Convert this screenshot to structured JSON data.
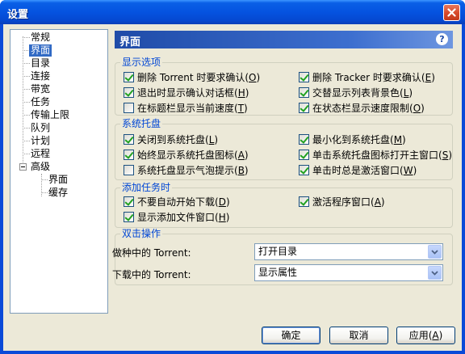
{
  "window": {
    "title": "设置"
  },
  "tree": {
    "items": [
      {
        "label": "常规"
      },
      {
        "label": "界面"
      },
      {
        "label": "目录"
      },
      {
        "label": "连接"
      },
      {
        "label": "带宽"
      },
      {
        "label": "任务"
      },
      {
        "label": "传输上限"
      },
      {
        "label": "队列"
      },
      {
        "label": "计划"
      },
      {
        "label": "远程"
      },
      {
        "label": "高级"
      },
      {
        "label": "界面"
      },
      {
        "label": "缓存"
      }
    ],
    "selected": "界面"
  },
  "header": {
    "title": "界面",
    "help": "?"
  },
  "groups": {
    "display": {
      "title": "显示选项",
      "items": [
        {
          "text": "删除 Torrent 时要求确认(",
          "key": "O",
          "end": ")",
          "checked": true
        },
        {
          "text": "删除 Tracker 时要求确认(",
          "key": "E",
          "end": ")",
          "checked": true
        },
        {
          "text": "退出时显示确认对话框(",
          "key": "H",
          "end": ")",
          "checked": true
        },
        {
          "text": "交替显示列表背景色(",
          "key": "L",
          "end": ")",
          "checked": true
        },
        {
          "text": "在标题栏显示当前速度(",
          "key": "T",
          "end": ")",
          "checked": false
        },
        {
          "text": "在状态栏显示速度限制(",
          "key": "O",
          "end": ")",
          "checked": true
        }
      ]
    },
    "tray": {
      "title": "系统托盘",
      "items": [
        {
          "text": "关闭到系统托盘(",
          "key": "L",
          "end": ")",
          "checked": true
        },
        {
          "text": "最小化到系统托盘(",
          "key": "M",
          "end": ")",
          "checked": true
        },
        {
          "text": "始终显示系统托盘图标(",
          "key": "A",
          "end": ")",
          "checked": true
        },
        {
          "text": "单击系统托盘图标打开主窗口(",
          "key": "S",
          "end": ")",
          "checked": true
        },
        {
          "text": "系统托盘显示气泡提示(",
          "key": "B",
          "end": ")",
          "checked": false
        },
        {
          "text": "单击时总是激活窗口(",
          "key": "W",
          "end": ")",
          "checked": true
        }
      ]
    },
    "addtask": {
      "title": "添加任务时",
      "items": [
        {
          "text": "不要自动开始下载(",
          "key": "D",
          "end": ")",
          "checked": true
        },
        {
          "text": "激活程序窗口(",
          "key": "A",
          "end": ")",
          "checked": true
        },
        {
          "text": "显示添加文件窗口(",
          "key": "H",
          "end": ")",
          "checked": true
        }
      ]
    },
    "dblclick": {
      "title": "双击操作",
      "seeding_label": "做种中的 Torrent:",
      "seeding_value": "打开目录",
      "downloading_label": "下载中的 Torrent:",
      "downloading_value": "显示属性"
    }
  },
  "buttons": {
    "ok": "确定",
    "cancel": "取消",
    "apply_text": "应用(",
    "apply_key": "A",
    "apply_end": ")"
  }
}
